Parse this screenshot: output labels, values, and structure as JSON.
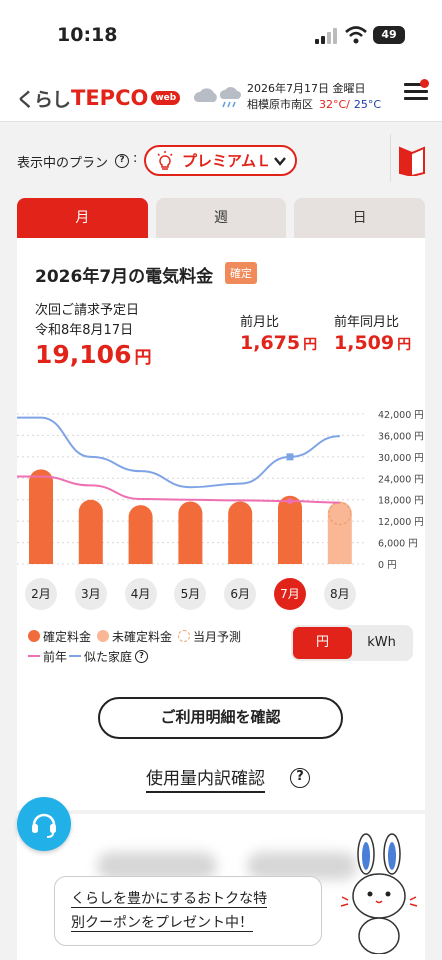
{
  "status_bar": {
    "time": "10:18",
    "battery": "49"
  },
  "header": {
    "logo_kurashi": "くらし",
    "logo_tepco": "TEPCO",
    "logo_web": "web",
    "date": "2026年7月17日  金曜日",
    "location": "相模原市南区",
    "temp_high": "32°C/",
    "temp_low": "25°C"
  },
  "plan": {
    "label": "表示中のプラン",
    "q": "?",
    "colon": ":",
    "value": "プレミアムＬ"
  },
  "tabs": [
    {
      "label": "月"
    },
    {
      "label": "週"
    },
    {
      "label": "日"
    }
  ],
  "bill": {
    "title": "2026年7月の電気料金",
    "badge": "確定",
    "next_label": "次回ご請求予定日",
    "next_date": "令和8年8月17日",
    "amount": "19,106",
    "yen": "円",
    "mom_label": "前月比",
    "mom_value": "1,675",
    "yoy_label": "前年同月比",
    "yoy_value": "1,509"
  },
  "chart_data": {
    "type": "bar",
    "categories": [
      "2月",
      "3月",
      "4月",
      "5月",
      "6月",
      "7月",
      "8月"
    ],
    "selected": "7月",
    "series": [
      {
        "name": "確定料金",
        "values": [
          26500,
          18000,
          16500,
          17500,
          17500,
          19106,
          null
        ]
      },
      {
        "name": "未確定料金",
        "values": [
          null,
          null,
          null,
          null,
          null,
          null,
          17500
        ]
      },
      {
        "name": "前年",
        "values": [
          24500,
          22000,
          18200,
          18000,
          17800,
          17600,
          17200
        ]
      },
      {
        "name": "似た家庭",
        "values": [
          41000,
          30000,
          26000,
          21500,
          22500,
          30000,
          35800
        ]
      }
    ],
    "colors": {
      "confirmed": "#f26b3a",
      "unconfirmed": "#f9b796",
      "prev_year": "#ee6fb2",
      "similar": "#7ea4e6"
    },
    "yticks": [
      "42,000 円",
      "36,000 円",
      "30,000 円",
      "24,000 円",
      "18,000 円",
      "12,000 円",
      "6,000 円",
      "0 円"
    ],
    "ylim": [
      0,
      42000
    ]
  },
  "legend": {
    "confirmed": "確定料金",
    "unconfirmed": "未確定料金",
    "forecast": "当月予測",
    "prev_year": "前年",
    "similar": "似た家庭",
    "q": "?"
  },
  "unit_toggle": {
    "yen": "円",
    "kwh": "kWh"
  },
  "actions": {
    "detail": "ご利用明細を確認",
    "usage": "使用量内訳確認",
    "q": "?"
  },
  "promo": {
    "line1": "くらしを豊かにするおトクな特",
    "line2": "別クーポンをプレゼント中！"
  }
}
